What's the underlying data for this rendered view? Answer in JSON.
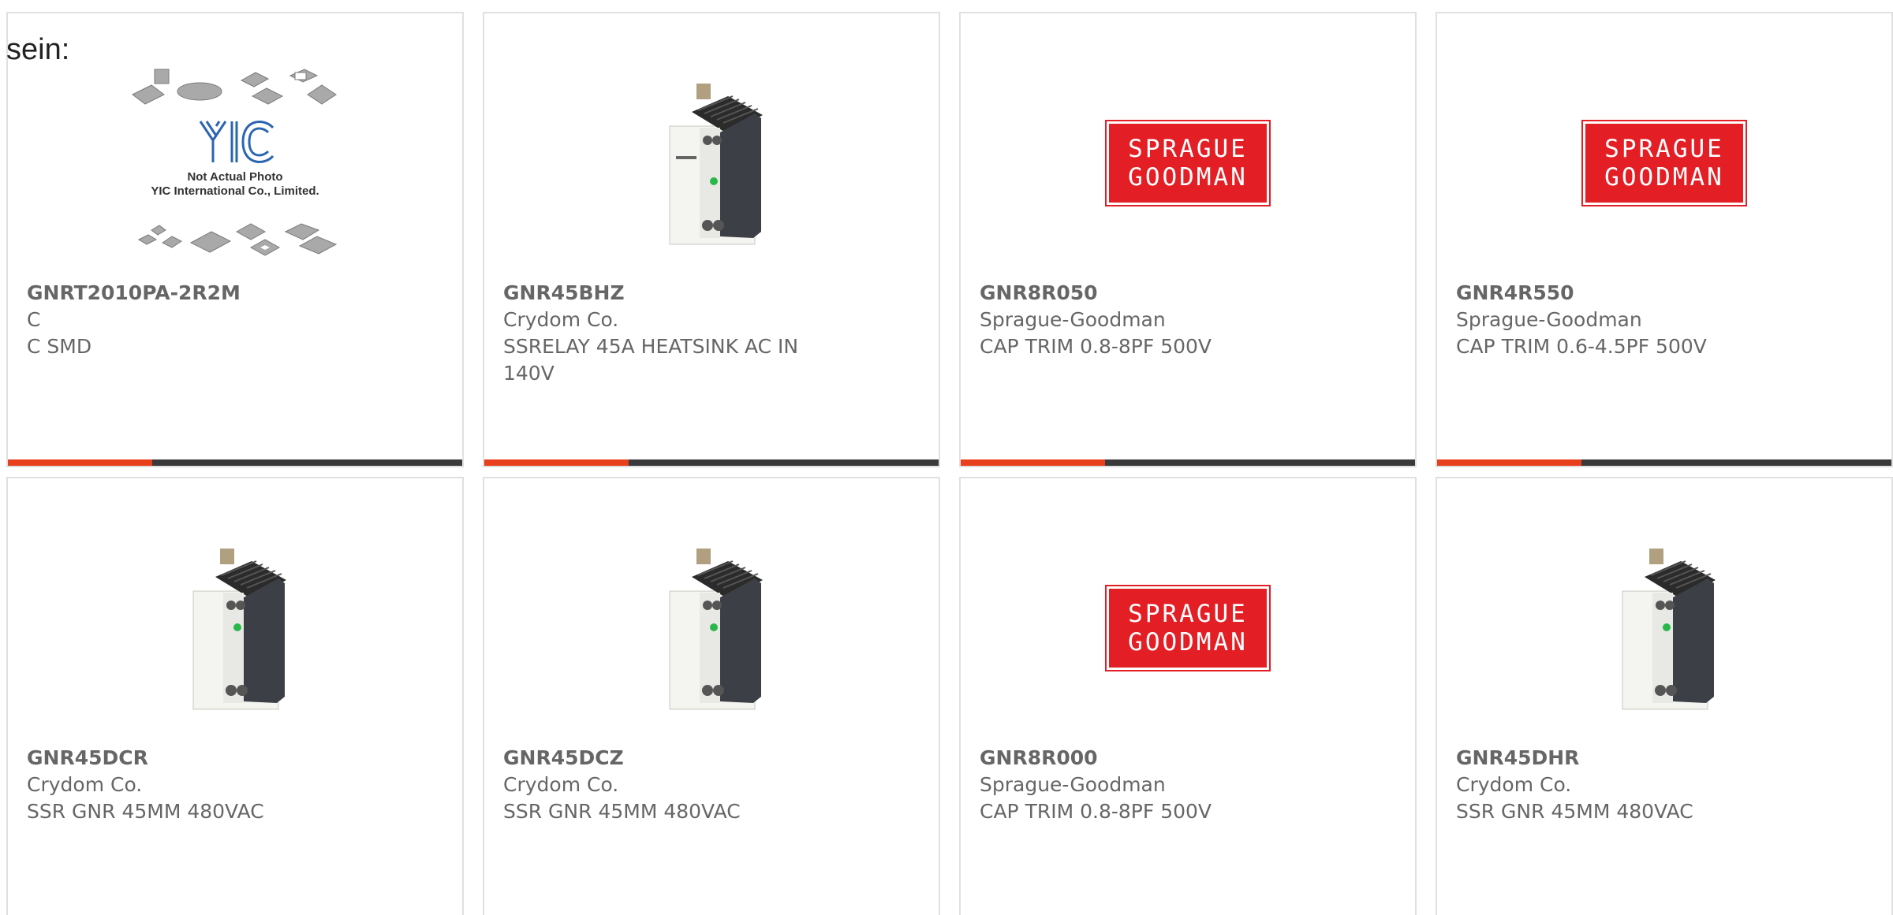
{
  "intro_text": "sein:",
  "products": [
    {
      "part_number": "GNRT2010PA-2R2M",
      "manufacturer": "C",
      "description": "C SMD",
      "image": "not-actual-photo",
      "image_caption_line1": "Not Actual Photo",
      "image_caption_line2": "YIC International Co., Limited.",
      "logo_text": "YIC"
    },
    {
      "part_number": "GNR45BHZ",
      "manufacturer": "Crydom Co.",
      "description": "SSRELAY 45A HEATSINK AC IN 140V",
      "image": "ssr-relay"
    },
    {
      "part_number": "GNR8R050",
      "manufacturer": "Sprague-Goodman",
      "description": "CAP TRIM 0.8-8PF 500V",
      "image": "sprague-logo",
      "logo_line1": "SPRAGUE",
      "logo_line2": "GOODMAN"
    },
    {
      "part_number": "GNR4R550",
      "manufacturer": "Sprague-Goodman",
      "description": "CAP TRIM 0.6-4.5PF 500V",
      "image": "sprague-logo",
      "logo_line1": "SPRAGUE",
      "logo_line2": "GOODMAN"
    },
    {
      "part_number": "GNR45DCR",
      "manufacturer": "Crydom Co.",
      "description": "SSR GNR 45MM 480VAC",
      "image": "ssr-relay"
    },
    {
      "part_number": "GNR45DCZ",
      "manufacturer": "Crydom Co.",
      "description": "SSR GNR 45MM 480VAC",
      "image": "ssr-relay"
    },
    {
      "part_number": "GNR8R000",
      "manufacturer": "Sprague-Goodman",
      "description": "CAP TRIM 0.8-8PF 500V",
      "image": "sprague-logo",
      "logo_line1": "SPRAGUE",
      "logo_line2": "GOODMAN"
    },
    {
      "part_number": "GNR45DHR",
      "manufacturer": "Crydom Co.",
      "description": "SSR GNR 45MM 480VAC",
      "image": "ssr-relay"
    }
  ],
  "colors": {
    "accent": "#e8401c",
    "bar_dark": "#3a3a3a",
    "card_border": "#e0e0e0",
    "text_gray": "#666666",
    "sprague_red": "#e31e24"
  }
}
